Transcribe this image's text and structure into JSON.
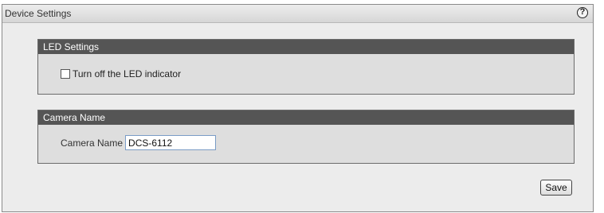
{
  "panel": {
    "title": "Device Settings",
    "help_icon": "help-icon",
    "help_glyph": "?"
  },
  "led_settings": {
    "title": "LED Settings",
    "checkbox_label": "Turn off the LED indicator",
    "checked": false
  },
  "camera_name": {
    "title": "Camera Name",
    "field_label": "Camera Name",
    "field_value": "DCS-6112"
  },
  "actions": {
    "save_label": "Save"
  }
}
